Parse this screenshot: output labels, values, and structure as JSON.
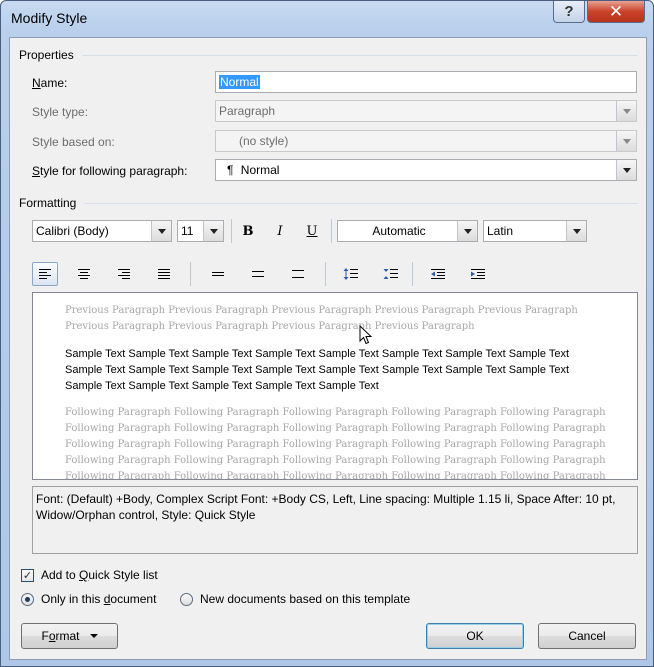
{
  "window": {
    "title": "Modify Style"
  },
  "properties": {
    "section_label": "Properties",
    "name_label": "Name:",
    "name_value": "Normal",
    "style_type_label": "Style type:",
    "style_type_value": "Paragraph",
    "based_on_label": "Style based on:",
    "based_on_value": "(no style)",
    "following_label": "Style for following paragraph:",
    "following_value": "Normal",
    "following_mark": "¶"
  },
  "formatting": {
    "section_label": "Formatting",
    "font": "Calibri (Body)",
    "size": "11",
    "bold": "B",
    "italic": "I",
    "underline": "U",
    "color": "Automatic",
    "script": "Latin"
  },
  "preview": {
    "previous_text": "Previous Paragraph Previous Paragraph Previous Paragraph Previous Paragraph Previous Paragraph Previous Paragraph Previous Paragraph Previous Paragraph Previous Paragraph",
    "sample_text": "Sample Text Sample Text Sample Text Sample Text Sample Text Sample Text Sample Text Sample Text Sample Text Sample Text Sample Text Sample Text Sample Text Sample Text Sample Text Sample Text Sample Text Sample Text Sample Text Sample Text Sample Text",
    "following_lines": [
      "Following Paragraph Following Paragraph Following Paragraph Following Paragraph Following Paragraph",
      "Following Paragraph Following Paragraph Following Paragraph Following Paragraph Following Paragraph",
      "Following Paragraph Following Paragraph Following Paragraph Following Paragraph Following Paragraph",
      "Following Paragraph Following Paragraph Following Paragraph Following Paragraph Following Paragraph",
      "Following Paragraph Following Paragraph Following Paragraph Following Paragraph Following Paragraph"
    ]
  },
  "description": "Font: (Default) +Body, Complex Script Font: +Body CS, Left, Line spacing:  Multiple 1.15 li, Space After:  10 pt, Widow/Orphan control, Style: Quick Style",
  "options": {
    "add_quick_style": "Add to Quick Style list",
    "add_quick_style_checked": true,
    "only_this_doc": "Only in this document",
    "new_docs": "New documents based on this template",
    "selected_scope": "only_this_doc"
  },
  "buttons": {
    "format": "Format",
    "ok": "OK",
    "cancel": "Cancel"
  },
  "icons": [
    "help-icon",
    "close-icon",
    "align-left-icon",
    "align-center-icon",
    "align-right-icon",
    "justify-icon",
    "single-spacing-icon",
    "one-half-spacing-icon",
    "double-spacing-icon",
    "increase-spacing-icon",
    "decrease-spacing-icon",
    "decrease-indent-icon",
    "increase-indent-icon",
    "mouse-cursor-icon"
  ]
}
